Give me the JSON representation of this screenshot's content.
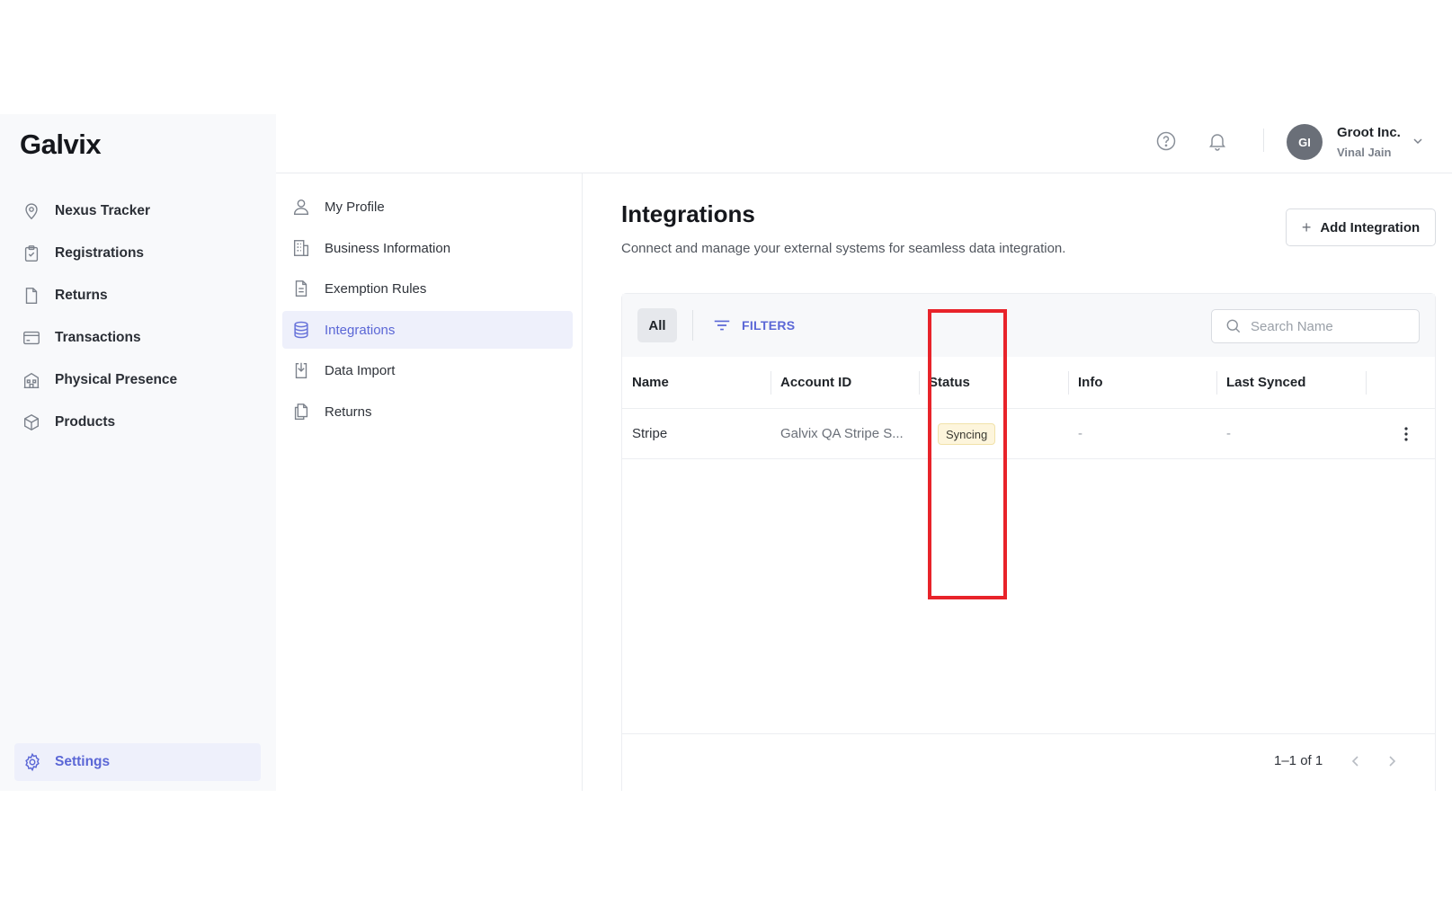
{
  "app": {
    "logo": "Galvix"
  },
  "sidebar": {
    "items": [
      {
        "label": "Nexus Tracker",
        "icon": "location-pin-icon"
      },
      {
        "label": "Registrations",
        "icon": "clipboard-icon"
      },
      {
        "label": "Returns",
        "icon": "document-icon"
      },
      {
        "label": "Transactions",
        "icon": "credit-card-icon"
      },
      {
        "label": "Physical Presence",
        "icon": "building-icon"
      },
      {
        "label": "Products",
        "icon": "cube-icon"
      }
    ],
    "settings": {
      "label": "Settings",
      "icon": "gear-icon"
    }
  },
  "header": {
    "avatar_initials": "GI",
    "org_name": "Groot Inc.",
    "user_name": "Vinal Jain"
  },
  "submenu": {
    "items": [
      {
        "label": "My Profile",
        "icon": "user-icon"
      },
      {
        "label": "Business Information",
        "icon": "office-building-icon"
      },
      {
        "label": "Exemption Rules",
        "icon": "file-text-icon"
      },
      {
        "label": "Integrations",
        "icon": "database-icon",
        "active": true
      },
      {
        "label": "Data Import",
        "icon": "download-file-icon"
      },
      {
        "label": "Returns",
        "icon": "copy-icon"
      }
    ]
  },
  "main": {
    "title": "Integrations",
    "subtitle": "Connect and manage your external systems for seamless data integration.",
    "add_button": "Add Integration",
    "tab_all": "All",
    "filters_label": "FILTERS",
    "search_placeholder": "Search Name",
    "columns": [
      "Name",
      "Account ID",
      "Status",
      "Info",
      "Last Synced"
    ],
    "rows": [
      {
        "name": "Stripe",
        "account_id": "Galvix QA Stripe S...",
        "status": "Syncing",
        "info": "-",
        "last_synced": "-"
      }
    ],
    "pagination": "1–1 of 1"
  },
  "colors": {
    "accent": "#5b67d6",
    "highlight_box": "#e8232a",
    "status_syncing_bg": "#fdf5dc"
  }
}
